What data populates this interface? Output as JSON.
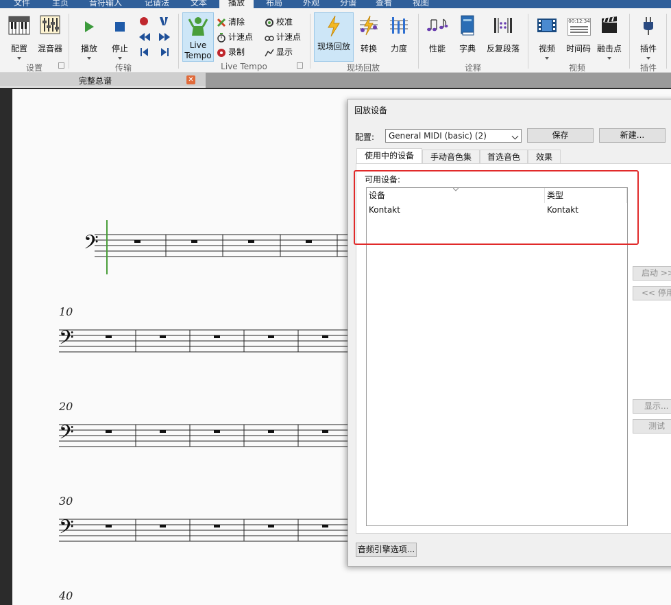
{
  "menu_tabs": [
    "文件",
    "主页",
    "音符输入",
    "记谱法",
    "文本",
    "播放",
    "布局",
    "外观",
    "分谱",
    "查看",
    "视图"
  ],
  "active_menu_tab": "播放",
  "ribbon": {
    "setup": {
      "group": "设置",
      "config": "配置",
      "mixer": "混音器"
    },
    "transport": {
      "group": "传输",
      "play": "播放",
      "stop": "停止"
    },
    "live_tempo": {
      "group": "Live Tempo",
      "button": "Live Tempo",
      "clear": "清除",
      "beats1": "计速点",
      "record": "录制",
      "calibrate": "校准",
      "beats2": "计速点",
      "show": "显示"
    },
    "live_playback": {
      "group": "现场回放",
      "live": "现场回放",
      "transform": "转换",
      "velocity": "力度"
    },
    "interpretation": {
      "group": "诠释",
      "performance": "性能",
      "dictionary": "字典",
      "repeats": "反复段落"
    },
    "video": {
      "group": "视频",
      "video": "视频",
      "timecode": "时间码",
      "timecode_display": "00:12:34",
      "hitpoints": "融击点"
    },
    "plugins": {
      "group": "插件",
      "plugins": "插件"
    }
  },
  "document_tab": {
    "title": "完整总谱"
  },
  "score": {
    "measure_numbers": [
      "10",
      "20",
      "30",
      "40"
    ]
  },
  "dialog": {
    "title": "回放设备",
    "config_label": "配置:",
    "config_value": "General MIDI (basic) (2)",
    "save": "保存",
    "new": "新建...",
    "tabs": [
      "使用中的设备",
      "手动音色集",
      "首选音色",
      "效果"
    ],
    "active_tab": 0,
    "available_label": "可用设备:",
    "columns": [
      "设备",
      "类型"
    ],
    "rows": [
      {
        "device": "Kontakt",
        "type": "Kontakt"
      }
    ],
    "activate": "启动 >>",
    "deactivate": "<< 停用",
    "show": "显示...",
    "test": "测试",
    "audio_engine": "音频引擎选项..."
  },
  "colors": {
    "accent_blue": "#2f5f9a",
    "highlight_red": "#e12a2a",
    "live_tempo_green": "#4a9e3a"
  }
}
